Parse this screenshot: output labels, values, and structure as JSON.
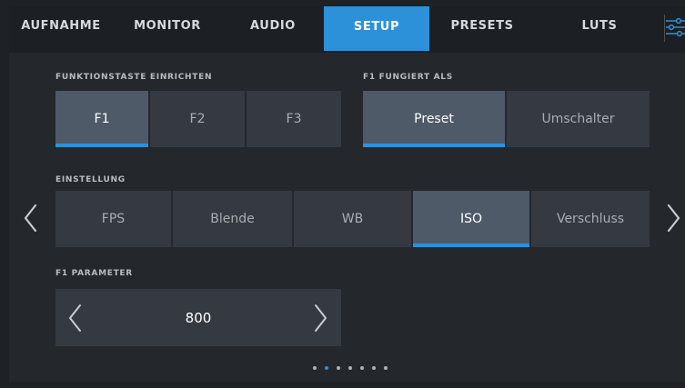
{
  "tabs": [
    {
      "label": "AUFNAHME",
      "active": false
    },
    {
      "label": "MONITOR",
      "active": false
    },
    {
      "label": "AUDIO",
      "active": false
    },
    {
      "label": "SETUP",
      "active": true
    },
    {
      "label": "PRESETS",
      "active": false
    },
    {
      "label": "LUTS",
      "active": false
    }
  ],
  "function_key": {
    "title": "FUNKTIONSTASTE EINRICHTEN",
    "options": [
      "F1",
      "F2",
      "F3"
    ],
    "selected": "F1"
  },
  "acts_as": {
    "title": "F1 FUNGIERT ALS",
    "options": [
      "Preset",
      "Umschalter"
    ],
    "selected": "Preset"
  },
  "setting": {
    "title": "EINSTELLUNG",
    "options": [
      "FPS",
      "Blende",
      "WB",
      "ISO",
      "Verschluss"
    ],
    "selected": "ISO"
  },
  "parameter": {
    "title": "F1 PARAMETER",
    "value": "800"
  },
  "pagination": {
    "total": 7,
    "current": 2
  },
  "colors": {
    "accent": "#2d91d9",
    "panel": "#353a42",
    "selected": "#4f5a68"
  },
  "icons": [
    "menu-sliders-icon",
    "chevron-left-icon",
    "chevron-right-icon"
  ]
}
